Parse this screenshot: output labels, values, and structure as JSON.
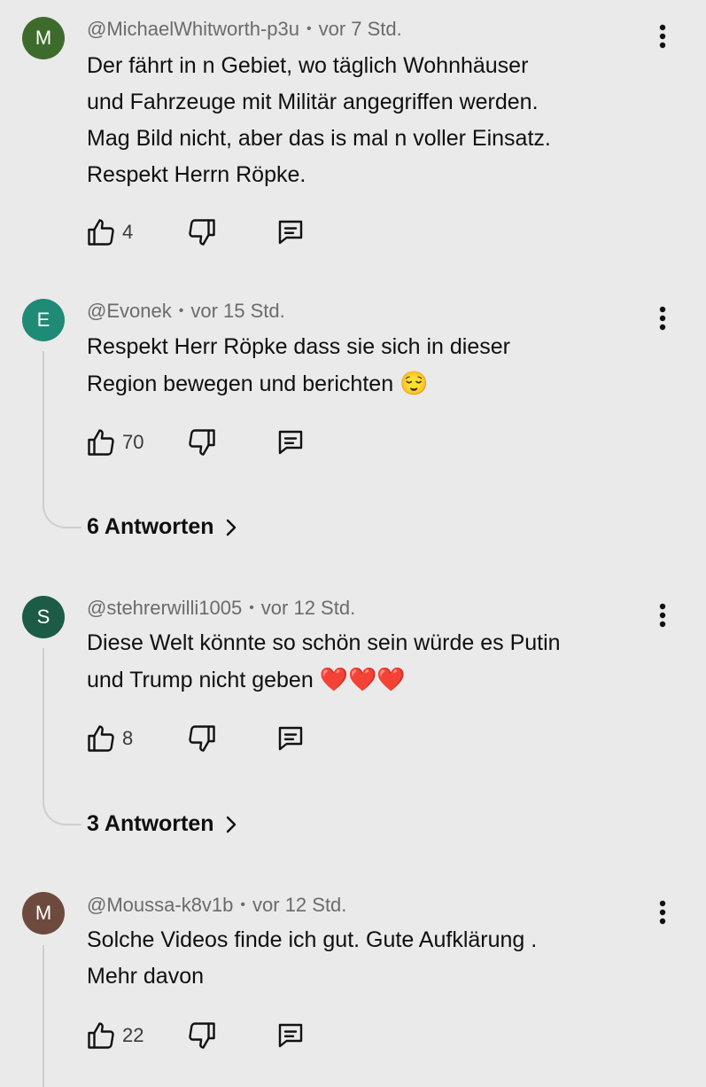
{
  "comments": [
    {
      "avatar_letter": "M",
      "avatar_color": "#3d6b2b",
      "author": "@MichaelWhitworth-p3u",
      "separator": "•",
      "time": "vor 7 Std.",
      "lines": [
        "Der fährt in n Gebiet, wo täglich Wohnhäuser",
        "und Fahrzeuge mit Militär angegriffen werden.",
        "Mag Bild nicht, aber das is mal n voller Einsatz.",
        "Respekt Herrn Röpke."
      ],
      "likes": "4"
    },
    {
      "avatar_letter": "E",
      "avatar_color": "#1f8a76",
      "author": "@Evonek",
      "separator": "•",
      "time": "vor 15 Std.",
      "lines": [
        "Respekt Herr Röpke dass sie sich in dieser",
        "Region bewegen und berichten"
      ],
      "emoji": "😌",
      "likes": "70",
      "replies_label": "6 Antworten"
    },
    {
      "avatar_letter": "S",
      "avatar_color": "#1c5b45",
      "author": "@stehrerwilli1005",
      "separator": "•",
      "time": "vor 12 Std.",
      "lines": [
        "Diese Welt könnte so schön sein würde es Putin",
        "und Trump nicht geben"
      ],
      "emoji": "❤️❤️❤️",
      "likes": "8",
      "replies_label": "3 Antworten"
    },
    {
      "avatar_letter": "M",
      "avatar_color": "#6e4a3e",
      "author": "@Moussa-k8v1b",
      "separator": "•",
      "time": "vor 12 Std.",
      "lines": [
        "Solche Videos finde ich gut.  Gute Aufklärung .",
        "Mehr davon"
      ],
      "likes": "22"
    }
  ],
  "icons": {
    "like": "thumbs-up-icon",
    "dislike": "thumbs-down-icon",
    "reply": "comment-icon",
    "more": "more-vertical-icon",
    "expand": "chevron-right-icon"
  }
}
